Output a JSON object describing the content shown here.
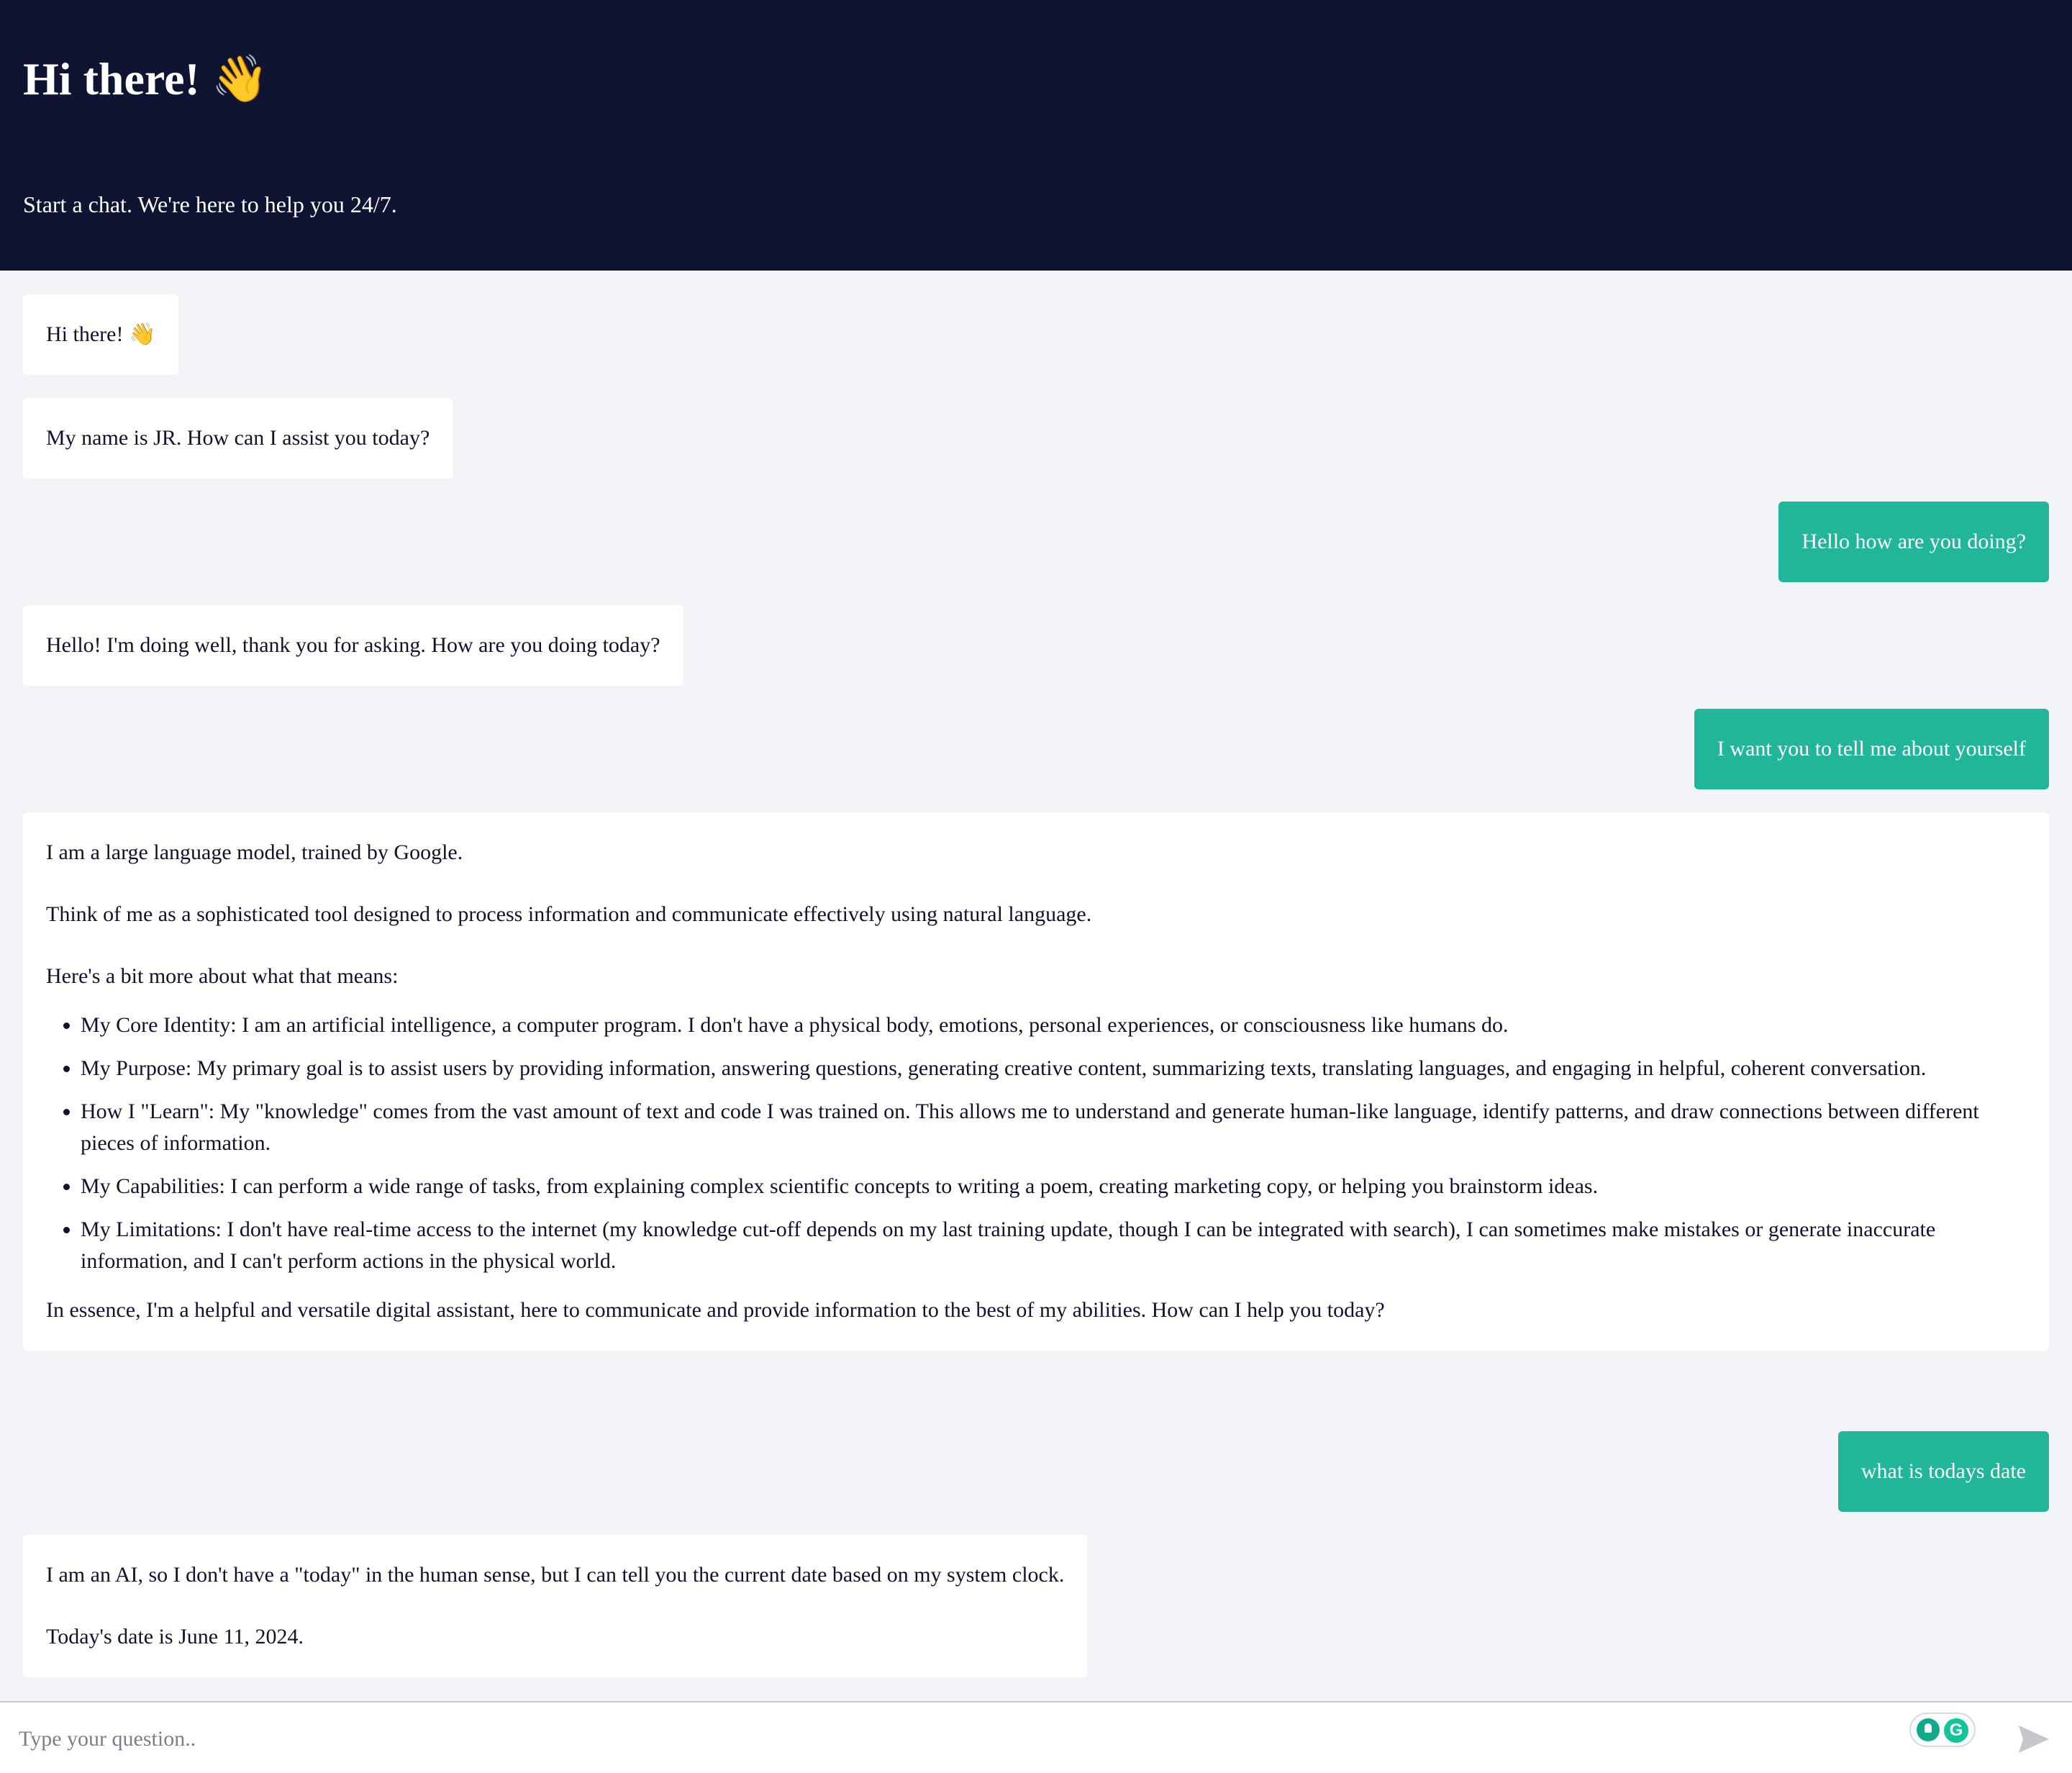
{
  "header": {
    "title": "Hi there! 👋",
    "subtitle": "Start a chat. We're here to help you 24/7."
  },
  "messages": [
    {
      "role": "bot",
      "paragraphs": [
        "Hi there! 👋"
      ]
    },
    {
      "role": "bot",
      "paragraphs": [
        "My name is JR. How can I assist you today?"
      ]
    },
    {
      "role": "user",
      "text": "Hello how are you doing?"
    },
    {
      "role": "bot",
      "paragraphs": [
        "Hello! I'm doing well, thank you for asking. How are you doing today?"
      ]
    },
    {
      "role": "user",
      "text": "I want you to tell me about yourself"
    },
    {
      "role": "bot",
      "paragraphs": [
        "I am a large language model, trained by Google.",
        "Think of me as a sophisticated tool designed to process information and communicate effectively using natural language.",
        "Here's a bit more about what that means:"
      ],
      "list": [
        "My Core Identity: I am an artificial intelligence, a computer program. I don't have a physical body, emotions, personal experiences, or consciousness like humans do.",
        "My Purpose: My primary goal is to assist users by providing information, answering questions, generating creative content, summarizing texts, translating languages, and engaging in helpful, coherent conversation.",
        "How I \"Learn\": My \"knowledge\" comes from the vast amount of text and code I was trained on. This allows me to understand and generate human-like language, identify patterns, and draw connections between different pieces of information.",
        "My Capabilities: I can perform a wide range of tasks, from explaining complex scientific concepts to writing a poem, creating marketing copy, or helping you brainstorm ideas.",
        "My Limitations: I don't have real-time access to the internet (my knowledge cut-off depends on my last training update, though I can be integrated with search), I can sometimes make mistakes or generate inaccurate information, and I can't perform actions in the physical world."
      ],
      "closing": "In essence, I'm a helpful and versatile digital assistant, here to communicate and provide information to the best of my abilities. How can I help you today?"
    },
    {
      "role": "user",
      "text": "what is todays date"
    },
    {
      "role": "bot",
      "paragraphs": [
        "I am an AI, so I don't have a \"today\" in the human sense, but I can tell you the current date based on my system clock.",
        "Today's date is June 11, 2024."
      ]
    }
  ],
  "input": {
    "placeholder": "Type your question..",
    "value": ""
  },
  "extensions": {
    "grammarly_glyph": "G"
  },
  "colors": {
    "header_bg": "#0f1432",
    "page_bg": "#f3f4f7",
    "user_bubble": "#21b69a",
    "bot_bubble": "#ffffff",
    "send_icon": "#c4c7cc"
  },
  "icons": {
    "send": "send-arrow-icon",
    "extension_1": "lightbulb-icon",
    "extension_2": "grammarly-icon"
  }
}
